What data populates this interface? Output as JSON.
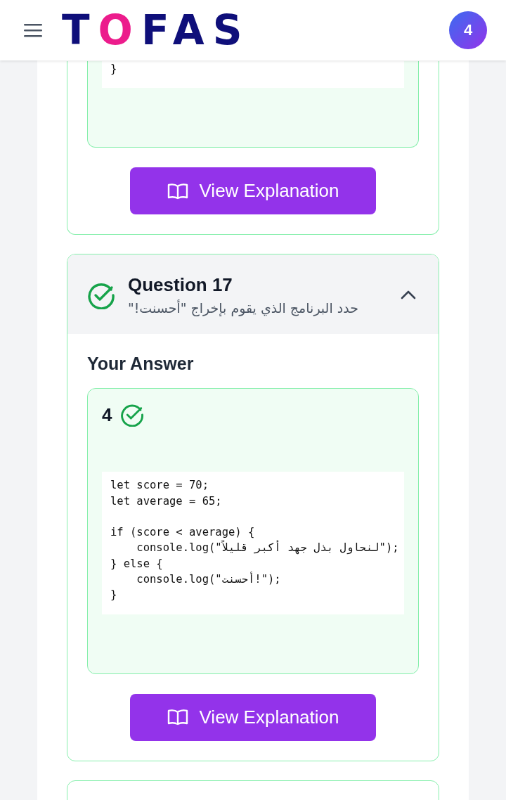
{
  "header": {
    "logo": {
      "lead": "T",
      "accent": "O",
      "rest": "FAS"
    },
    "avatar": "4"
  },
  "questions": [
    {
      "answer": {
        "correct": true,
        "code": "}"
      },
      "button": "View Explanation"
    },
    {
      "header": {
        "title": "Question 17",
        "prompt": "حدد البرنامج الذي يقوم بإخراج \"أحسنت!\"",
        "correct": true,
        "expanded": true
      },
      "answer_label": "Your Answer",
      "answer": {
        "option": "4",
        "correct": true,
        "code": "let score = 70;\nlet average = 65;\n\nif (score < average) {\n    console.log(\"لنحاول بذل جهد أكبر قليلاً\");\n} else {\n    console.log(\"أحسنت!\");\n}"
      },
      "button": "View Explanation"
    }
  ]
}
